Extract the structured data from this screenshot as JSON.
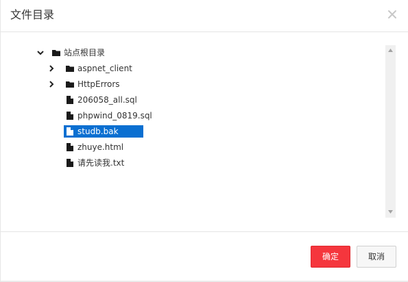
{
  "dialog": {
    "title": "文件目录",
    "close_icon": "close-icon"
  },
  "tree": {
    "root": {
      "label": "站点根目录",
      "expanded": true,
      "icon": "folder-icon"
    },
    "items": [
      {
        "label": "aspnet_client",
        "type": "folder",
        "icon": "folder-icon",
        "expandable": true,
        "selected": false
      },
      {
        "label": "HttpErrors",
        "type": "folder",
        "icon": "folder-icon",
        "expandable": true,
        "selected": false
      },
      {
        "label": "206058_all.sql",
        "type": "file",
        "icon": "file-icon",
        "expandable": false,
        "selected": false
      },
      {
        "label": "phpwind_0819.sql",
        "type": "file",
        "icon": "file-icon",
        "expandable": false,
        "selected": false
      },
      {
        "label": "studb.bak",
        "type": "file",
        "icon": "file-icon",
        "expandable": false,
        "selected": true
      },
      {
        "label": "zhuye.html",
        "type": "file",
        "icon": "file-icon",
        "expandable": false,
        "selected": false
      },
      {
        "label": "请先读我.txt",
        "type": "file",
        "icon": "file-icon",
        "expandable": false,
        "selected": false
      }
    ]
  },
  "footer": {
    "ok_label": "确定",
    "cancel_label": "取消"
  },
  "colors": {
    "ok_button": "#f5363d",
    "selected_row": "#0a6fd1"
  }
}
